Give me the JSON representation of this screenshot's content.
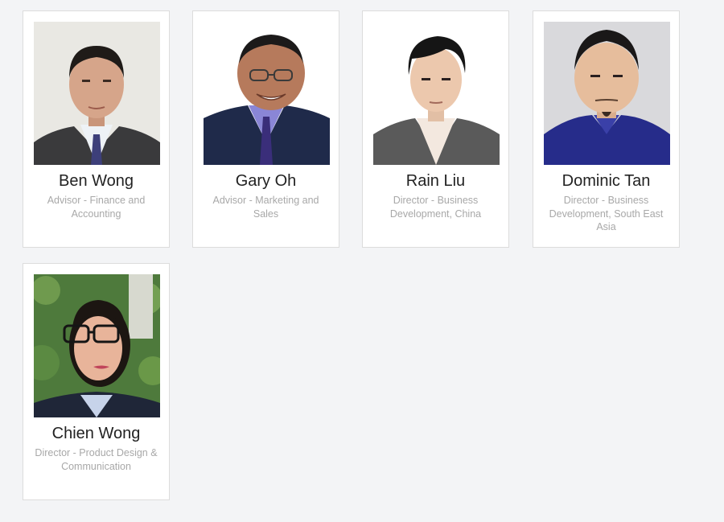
{
  "colors": {
    "page_background": "#f3f4f6",
    "card_background": "#ffffff",
    "name_text": "#222222",
    "role_text": "#a8a8a8"
  },
  "team": [
    {
      "name": "Ben Wong",
      "role": "Advisor - Finance and Accounting"
    },
    {
      "name": "Gary Oh",
      "role": "Advisor - Marketing and Sales"
    },
    {
      "name": "Rain Liu",
      "role": "Director - Business Development, China"
    },
    {
      "name": "Dominic Tan",
      "role": "Director - Business Development, South East Asia"
    },
    {
      "name": "Chien Wong",
      "role": "Director - Product Design & Communication"
    }
  ]
}
